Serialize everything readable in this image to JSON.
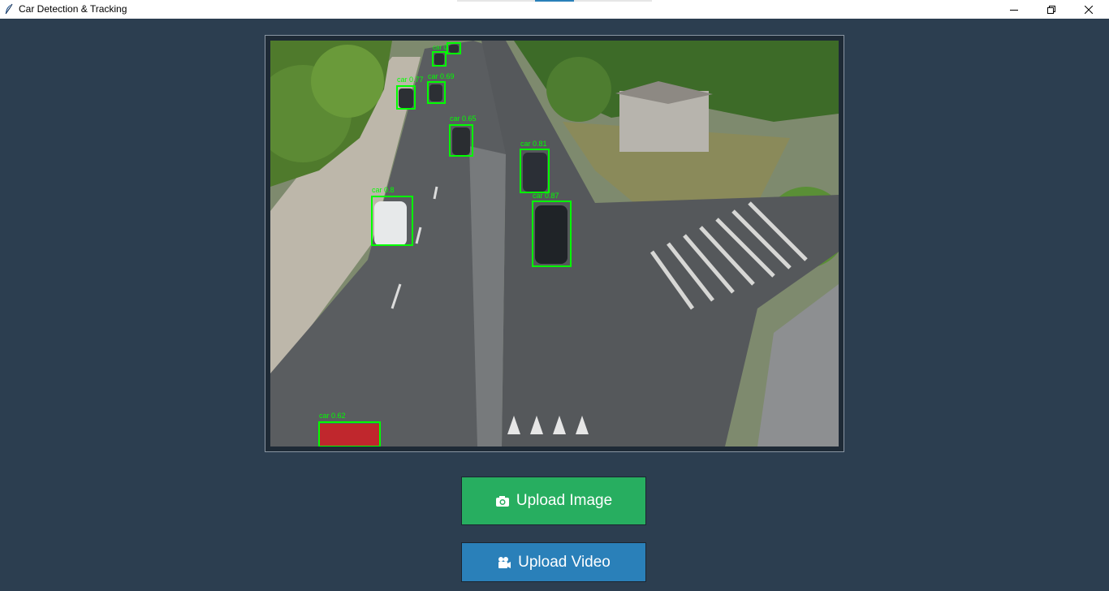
{
  "window": {
    "title": "Car Detection & Tracking",
    "icon": "feather-icon",
    "controls": [
      "minimize-icon",
      "restore-icon",
      "close-icon"
    ]
  },
  "colors": {
    "background": "#2c3e50",
    "detection_box": "#00ff00",
    "upload_image_button": "#27ae60",
    "upload_video_button": "#2a80b9"
  },
  "image_panel": {
    "detections": [
      {
        "label": "car 0.62"
      },
      {
        "label": "car 0.8"
      },
      {
        "label": "car 0.65"
      },
      {
        "label": "car 0.77"
      },
      {
        "label": "car 0.69"
      },
      {
        "label": "car 0.78"
      },
      {
        "label": "car 0.81"
      },
      {
        "label": "car 0.87"
      },
      {
        "label": "car 0.82"
      }
    ]
  },
  "buttons": {
    "upload_image": {
      "label": "Upload Image",
      "icon": "camera-icon"
    },
    "upload_video": {
      "label": "Upload Video",
      "icon": "video-camera-icon"
    }
  }
}
